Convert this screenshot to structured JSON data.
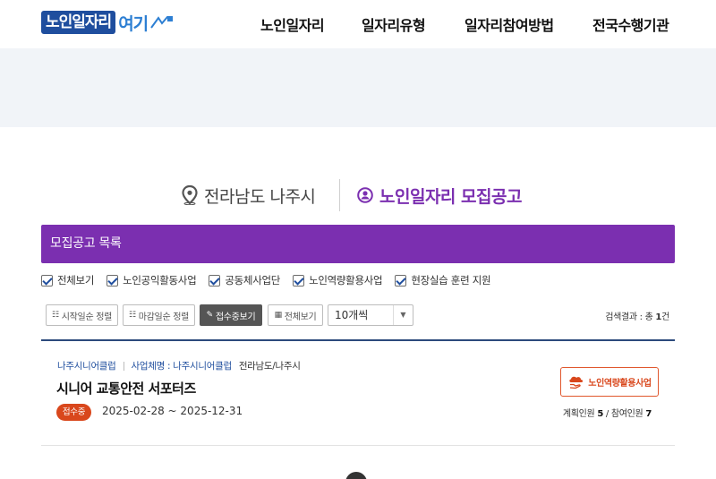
{
  "header": {
    "logo_main": "노인일자리",
    "logo_accent": "여기",
    "nav": [
      {
        "label": "노인일자리"
      },
      {
        "label": "일자리유형"
      },
      {
        "label": "일자리참여방법"
      },
      {
        "label": "전국수행기관"
      }
    ]
  },
  "location": {
    "label": "전라남도 나주시"
  },
  "page_title": "노인일자리 모집공고",
  "list_header": "모집공고 목록",
  "filters": [
    {
      "label": "전체보기",
      "checked": true
    },
    {
      "label": "노인공익활동사업",
      "checked": true
    },
    {
      "label": "공동체사업단",
      "checked": true
    },
    {
      "label": "노인역량활용사업",
      "checked": true
    },
    {
      "label": "현장실습 훈련 지원",
      "checked": true
    }
  ],
  "toolbar": {
    "sort_start": "시작일순 정렬",
    "sort_end": "마감일순 정렬",
    "receiving_only": "접수중보기",
    "view_all": "전체보기",
    "page_size": "10개씩",
    "result_prefix": "검색결과 : 총 ",
    "result_count": "1",
    "result_suffix": "건"
  },
  "listings": [
    {
      "organization": "나주시니어클럽",
      "business_name": "사업체명 : 나주시니어클럽",
      "region": "전라남도/나주시",
      "title": "시니어 교통안전 서포터즈",
      "status": "접수중",
      "period": "2025-02-28 ~ 2025-12-31",
      "type": "노인역량활용사업",
      "planned_label": "계획인원 ",
      "planned": "5",
      "separator": " / ",
      "participants_label": "참여인원 ",
      "participants": "7"
    }
  ],
  "colors": {
    "brand_purple": "#7b2fb0",
    "brand_navy": "#1f4e9e",
    "status_orange": "#d9471c"
  },
  "icons": [
    "map-pin-icon",
    "user-circle-icon",
    "list-icon",
    "pencil-icon",
    "grid-icon",
    "chevron-down-icon",
    "cloud-hand-icon"
  ]
}
